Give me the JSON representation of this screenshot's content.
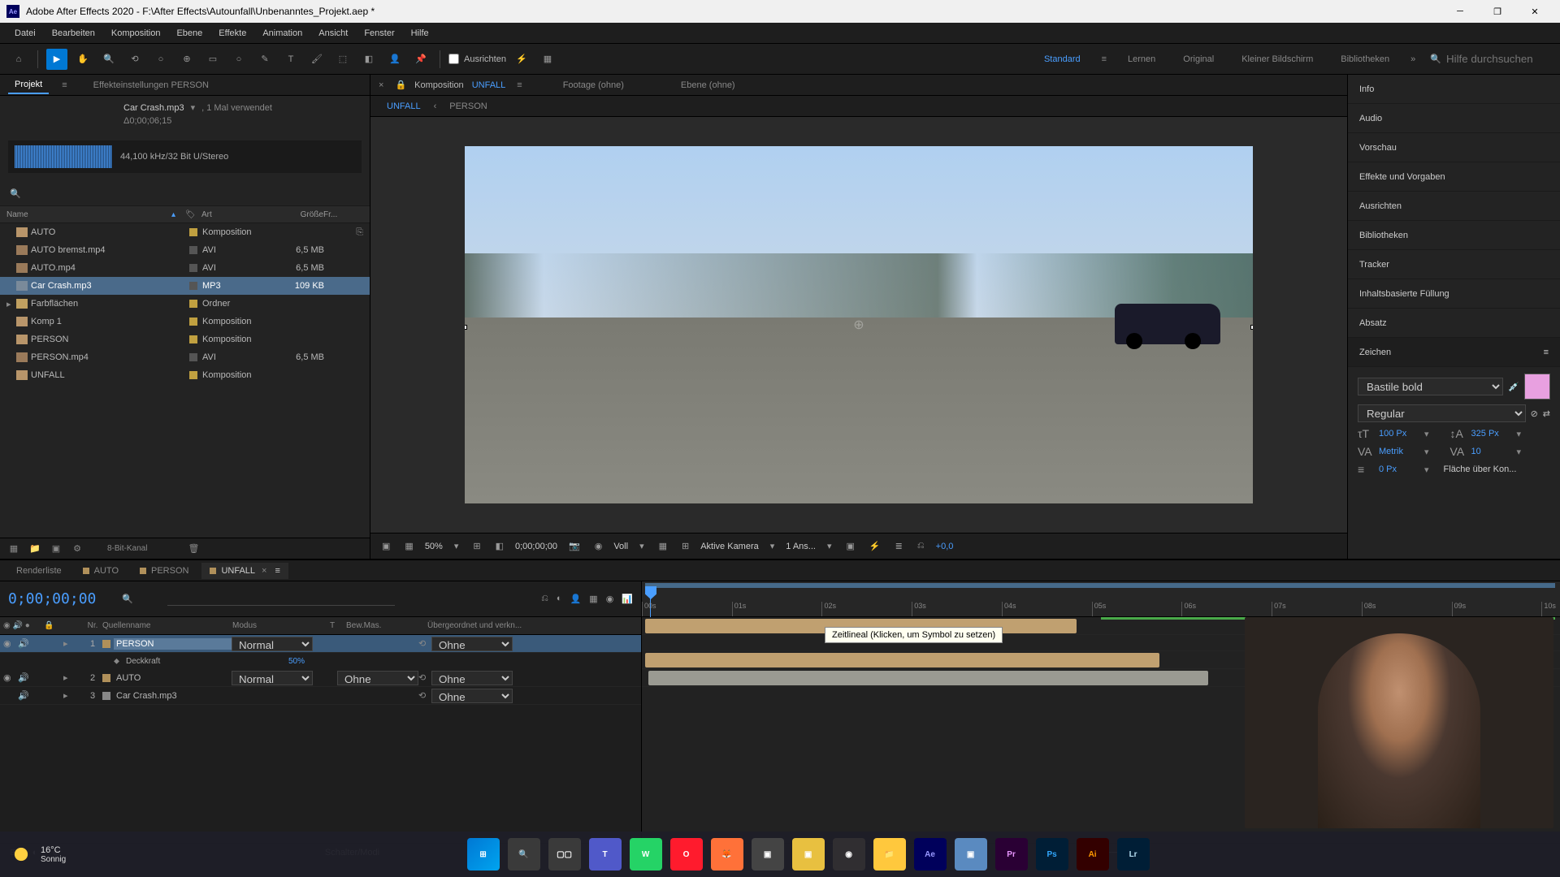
{
  "titlebar": {
    "app": "Ae",
    "title": "Adobe After Effects 2020 - F:\\After Effects\\Autounfall\\Unbenanntes_Projekt.aep *"
  },
  "menu": [
    "Datei",
    "Bearbeiten",
    "Komposition",
    "Ebene",
    "Effekte",
    "Animation",
    "Ansicht",
    "Fenster",
    "Hilfe"
  ],
  "toolbar": {
    "align_label": "Ausrichten"
  },
  "workspaces": {
    "items": [
      "Standard",
      "Lernen",
      "Original",
      "Kleiner Bildschirm",
      "Bibliotheken"
    ],
    "active": "Standard",
    "search_placeholder": "Hilfe durchsuchen"
  },
  "project": {
    "tab": "Projekt",
    "effect_settings": "Effekteinstellungen",
    "effect_target": "PERSON",
    "asset_name": "Car Crash.mp3",
    "asset_usage": ", 1 Mal verwendet",
    "asset_duration": "Δ0;00;06;15",
    "wave_info": "44,100 kHz/32 Bit U/Stereo",
    "columns": {
      "name": "Name",
      "type": "Art",
      "size": "Größe",
      "fr": "Fr..."
    },
    "items": [
      {
        "exp": "",
        "icon": "comp",
        "name": "AUTO",
        "type": "Komposition",
        "size": "",
        "label": "yellow",
        "link": true
      },
      {
        "exp": "",
        "icon": "vid",
        "name": "AUTO bremst.mp4",
        "type": "AVI",
        "size": "6,5 MB",
        "label": "none"
      },
      {
        "exp": "",
        "icon": "vid",
        "name": "AUTO.mp4",
        "type": "AVI",
        "size": "6,5 MB",
        "label": "none"
      },
      {
        "exp": "",
        "icon": "aud",
        "name": "Car Crash.mp3",
        "type": "MP3",
        "size": "109 KB",
        "label": "none",
        "selected": true
      },
      {
        "exp": "▸",
        "icon": "folder",
        "name": "Farbflächen",
        "type": "Ordner",
        "size": "",
        "label": "yellow"
      },
      {
        "exp": "",
        "icon": "comp",
        "name": "Komp 1",
        "type": "Komposition",
        "size": "",
        "label": "yellow"
      },
      {
        "exp": "",
        "icon": "comp",
        "name": "PERSON",
        "type": "Komposition",
        "size": "",
        "label": "yellow"
      },
      {
        "exp": "",
        "icon": "vid",
        "name": "PERSON.mp4",
        "type": "AVI",
        "size": "6,5 MB",
        "label": "none"
      },
      {
        "exp": "",
        "icon": "comp",
        "name": "UNFALL",
        "type": "Komposition",
        "size": "",
        "label": "yellow"
      }
    ],
    "bit_depth": "8-Bit-Kanal"
  },
  "comp": {
    "header_label": "Komposition",
    "header_name": "UNFALL",
    "footage_label": "Footage",
    "footage_value": "(ohne)",
    "layer_label": "Ebene",
    "layer_value": "(ohne)",
    "tabs": [
      "UNFALL",
      "PERSON"
    ],
    "active_tab": "UNFALL"
  },
  "viewer": {
    "zoom": "50%",
    "timecode": "0;00;00;00",
    "res": "Voll",
    "camera": "Aktive Kamera",
    "views": "1 Ans...",
    "exposure": "+0,0"
  },
  "right_panels": [
    "Info",
    "Audio",
    "Vorschau",
    "Effekte und Vorgaben",
    "Ausrichten",
    "Bibliotheken",
    "Tracker",
    "Inhaltsbasierte Füllung",
    "Absatz",
    "Zeichen"
  ],
  "character": {
    "font": "Bastile bold",
    "style": "Regular",
    "size": "100 Px",
    "leading": "325 Px",
    "kerning": "Metrik",
    "tracking": "10",
    "stroke": "0 Px",
    "fill_label": "Fläche über Kon..."
  },
  "timeline": {
    "tabs": [
      {
        "name": "Renderliste",
        "active": false,
        "dot": false
      },
      {
        "name": "AUTO",
        "active": false,
        "dot": true
      },
      {
        "name": "PERSON",
        "active": false,
        "dot": true
      },
      {
        "name": "UNFALL",
        "active": true,
        "dot": true
      }
    ],
    "timecode": "0;00;00;00",
    "cols": {
      "nr": "Nr.",
      "name": "Quellenname",
      "mode": "Modus",
      "t": "T",
      "bew": "Bew.Mas.",
      "parent": "Übergeordnet und verkn..."
    },
    "layers": [
      {
        "nr": "1",
        "name": "PERSON",
        "mode": "Normal",
        "bew": "",
        "parent": "Ohne",
        "color": "tan",
        "selected": true,
        "editing": true,
        "vis": true,
        "aud": true
      },
      {
        "nr": "2",
        "name": "AUTO",
        "mode": "Normal",
        "bew": "Ohne",
        "parent": "Ohne",
        "color": "tan",
        "vis": true,
        "aud": true
      },
      {
        "nr": "3",
        "name": "Car Crash.mp3",
        "mode": "",
        "bew": "",
        "parent": "Ohne",
        "color": "gray",
        "aud": true
      }
    ],
    "prop": {
      "name": "Deckkraft",
      "value": "50%"
    },
    "ruler_ticks": [
      "00s",
      "01s",
      "02s",
      "03s",
      "04s",
      "05s",
      "06s",
      "07s",
      "08s",
      "09s",
      "10s"
    ],
    "tooltip": "Zeitlineal (Klicken, um Symbol zu setzen)",
    "footer_text": "Schalter/Modi"
  },
  "taskbar": {
    "temp": "16°C",
    "condition": "Sonnig",
    "apps": [
      "Win",
      "Search",
      "Task",
      "Teams",
      "WA",
      "O",
      "FF",
      "App",
      "Y",
      "OBS",
      "Fold",
      "Ae",
      "App2",
      "Pr",
      "Ps",
      "Ai",
      "Lr"
    ]
  }
}
